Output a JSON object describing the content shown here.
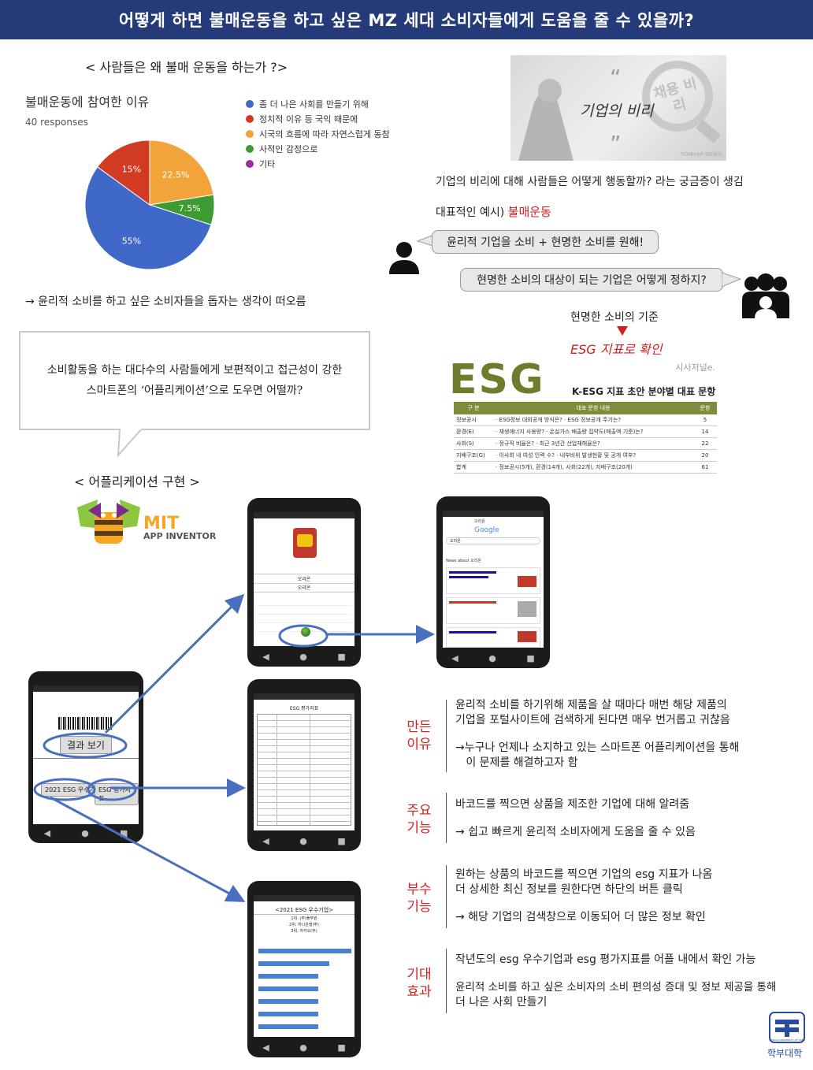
{
  "header": {
    "title": "어떻게 하면 불매운동을 하고 싶은 MZ 세대 소비자들에게 도움을 줄 수 있을까?"
  },
  "why": {
    "heading": "< 사람들은 왜 불매 운동을 하는가 ?>",
    "chart_title": "불매운동에 참여한 이유",
    "chart_sub": "40 responses",
    "conclusion": "→ 윤리적 소비를 하고 싶은 소비자들을 돕자는 생각이 떠오름"
  },
  "chart_data": {
    "type": "pie",
    "title": "불매운동에 참여한 이유",
    "subtitle": "40 responses",
    "legend_position": "right",
    "slices": [
      {
        "label": "좀 더 나은 사회를 만들기 위해",
        "value": 55,
        "display": "55%",
        "color": "#3f68c8"
      },
      {
        "label": "정치적 이유 등 국익 때문에",
        "value": 15,
        "display": "15%",
        "color": "#d13b24"
      },
      {
        "label": "시국의 흐름에 따라 자연스럽게 동참",
        "value": 22.5,
        "display": "22.5%",
        "color": "#f2a43a"
      },
      {
        "label": "사적인 감정으로",
        "value": 7.5,
        "display": "7.5%",
        "color": "#3e9b32"
      },
      {
        "label": "기타",
        "value": 0,
        "display": "",
        "color": "#9a2ea7"
      }
    ]
  },
  "corruption": {
    "photo_caption": "기업의 비리",
    "photo_stamp": "채용 비리",
    "photo_credit": "YONHAP NEWS",
    "line1": "기업의 비리에 대해 사람들은 어떻게 행동할까? 라는 궁금증이 생김",
    "line2_prefix": "대표적인 예시) ",
    "line2_highlight": "불매운동",
    "bubble1": "윤리적 기업을 소비 + 현명한 소비를 원해!",
    "bubble2": "현명한 소비의 대상이 되는 기업은 어떻게 정하지?",
    "criteria": "현명한 소비의 기준",
    "esg_check": "ESG 지표로 확인"
  },
  "esg_table": {
    "logo": "ESG",
    "source": "시사저널e.",
    "title": "K-ESG 지표 초안 분야별 대표 문항",
    "headers": [
      "구 분",
      "대표 문항 내용",
      "문항"
    ],
    "rows": [
      {
        "cat": "정보공시",
        "content": "· ESG정보 대외공개 방식은?   · ESG 정보공개 주기는?",
        "n": "5"
      },
      {
        "cat": "환경(E)",
        "content": "· 재생에너지 사용량?   · 온실가스 배출량 집약도(매출액 기준)는?",
        "n": "14"
      },
      {
        "cat": "사회(S)",
        "content": "· 정규직 비율은?   · 최근 3년간 산업재해율은?",
        "n": "22"
      },
      {
        "cat": "지배구조(G)",
        "content": "· 이사회 내 여성 인력 수?   · 내부비위 발생현황 및 공개 여부?",
        "n": "20"
      },
      {
        "cat": "합계",
        "content": "· 정보공시(5개), 환경(14개), 사회(22개), 지배구조(20개)",
        "n": "61"
      }
    ]
  },
  "callout": {
    "line1": "소비활동을 하는 대다수의 사람들에게 보편적이고 접근성이 강한",
    "line2": "스마트폰의 ‘어플리케이션’으로 도우면 어떨까?"
  },
  "app": {
    "heading": "< 어플리케이션 구현 >",
    "logo_mit": "MIT",
    "logo_sub": "APP INVENTOR",
    "main_phone": {
      "result_button": "결과 보기",
      "top_button": "2021 ESG 우수기업",
      "index_button": "ESG 평가지표"
    },
    "phone_product": {
      "label1": "오리온",
      "label2": "오리온"
    },
    "phone_search": {
      "query": "오리온",
      "brand": "Google",
      "news_header": "News about 오리온"
    },
    "phone_index": {
      "title": "ESG 평가지표"
    },
    "phone_best": {
      "title": "<2021 ESG 우수기업>",
      "rank1": "1위: (주)풀무원",
      "rank2": "2위: 하나은행(주)",
      "rank3": "3위: 카카오(주)"
    }
  },
  "sections": [
    {
      "label_line1": "만든",
      "label_line2": "이유",
      "p1": "윤리적 소비를 하기위해 제품을 살 때마다 매번 해당 제품의",
      "p2": "기업을 포털사이트에 검색하게 된다면 매우 번거롭고 귀찮음",
      "p3": "→누구나 언제나 소지하고 있는 스마트폰 어플리케이션을 통해",
      "p4": "   이 문제를 해결하고자 함"
    },
    {
      "label_line1": "주요",
      "label_line2": "기능",
      "p1": "바코드를 찍으면 상품을 제조한 기업에 대해 알려줌",
      "p2": "→  쉽고 빠르게 윤리적 소비자에게 도움을 줄 수 있음"
    },
    {
      "label_line1": "부수",
      "label_line2": "기능",
      "p1": "원하는 상품의 바코드를 찍으면 기업의 esg 지표가 나옴",
      "p2": "더 상세한 최신 정보를 원한다면 하단의 버튼 클릭",
      "p3": "→  해당 기업의 검색창으로 이동되어 더 많은 정보 확인"
    },
    {
      "label_line1": "기대",
      "label_line2": "효과",
      "p1": "작년도의 esg 우수기업과 esg 평가지표를 어플 내에서 확인 가능",
      "p2": "윤리적 소비를 하고 싶은 소비자의 소비 편의성 증대 및 정보 제공을 통해",
      "p3": "더 나은 사회 만들기"
    }
  ],
  "footer": {
    "school": "학부대학",
    "seal_text": "CATHOLIC UNIVERSITY OF KOREA"
  }
}
